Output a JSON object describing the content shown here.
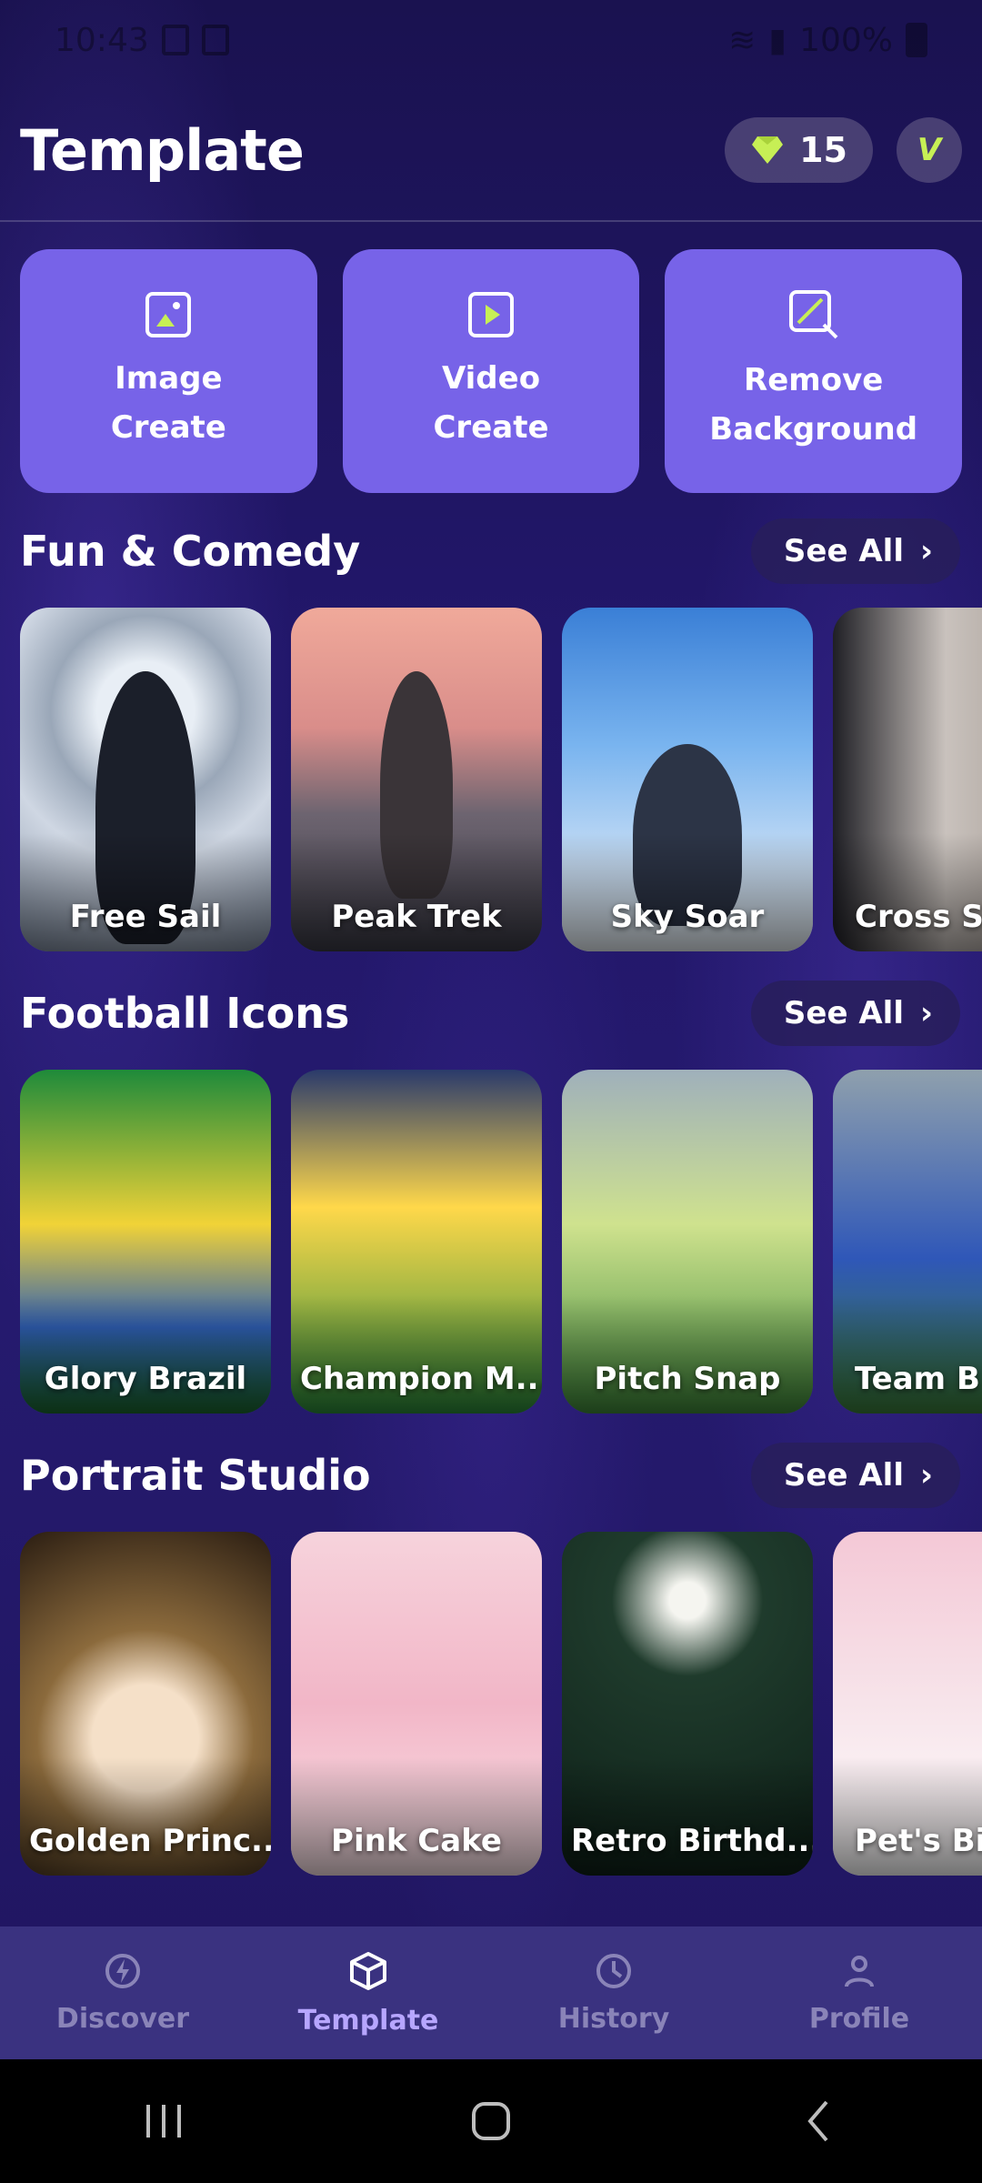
{
  "status_bar": {
    "time": "10:43",
    "battery": "100%"
  },
  "header": {
    "title": "Template",
    "credits": "15",
    "vip": "V"
  },
  "actions": [
    {
      "label": "Image\nCreate",
      "icon": "image-icon"
    },
    {
      "label": "Video\nCreate",
      "icon": "play-icon"
    },
    {
      "label": "Remove\nBackground",
      "icon": "remove-bg-icon"
    }
  ],
  "sections": [
    {
      "title": "Fun & Comedy",
      "see_all": "See All",
      "cards": [
        "Free Sail",
        "Peak Trek",
        "Sky Soar",
        "Cross Sp"
      ]
    },
    {
      "title": "Football Icons",
      "see_all": "See All",
      "cards": [
        "Glory Brazil",
        "Champion M...",
        "Pitch Snap",
        "Team B"
      ]
    },
    {
      "title": "Portrait Studio",
      "see_all": "See All",
      "cards": [
        "Golden Princ...",
        "Pink Cake",
        "Retro Birthd...",
        "Pet's Bir"
      ]
    }
  ],
  "nav": {
    "discover": "Discover",
    "template": "Template",
    "history": "History",
    "profile": "Profile"
  },
  "colors": {
    "accent": "#7763e8",
    "gem": "#c7ef55",
    "nav_bg": "#3a3280"
  }
}
